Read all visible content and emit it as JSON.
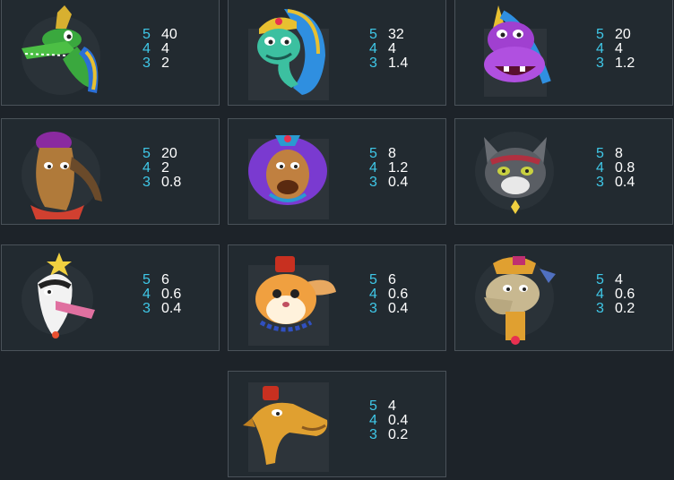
{
  "paytable": {
    "symbols": [
      {
        "icon": "crocodile-pharaoh-icon",
        "pays": [
          {
            "count": "5",
            "value": "40"
          },
          {
            "count": "4",
            "value": "4"
          },
          {
            "count": "3",
            "value": "2"
          }
        ]
      },
      {
        "icon": "cobra-icon",
        "pays": [
          {
            "count": "5",
            "value": "32"
          },
          {
            "count": "4",
            "value": "4"
          },
          {
            "count": "3",
            "value": "1.4"
          }
        ]
      },
      {
        "icon": "hippo-icon",
        "pays": [
          {
            "count": "5",
            "value": "20"
          },
          {
            "count": "4",
            "value": "4"
          },
          {
            "count": "3",
            "value": "1.2"
          }
        ]
      },
      {
        "icon": "goat-icon",
        "pays": [
          {
            "count": "5",
            "value": "20"
          },
          {
            "count": "4",
            "value": "2"
          },
          {
            "count": "3",
            "value": "0.8"
          }
        ]
      },
      {
        "icon": "lion-icon",
        "pays": [
          {
            "count": "5",
            "value": "8"
          },
          {
            "count": "4",
            "value": "1.2"
          },
          {
            "count": "3",
            "value": "0.4"
          }
        ]
      },
      {
        "icon": "cat-icon",
        "pays": [
          {
            "count": "5",
            "value": "8"
          },
          {
            "count": "4",
            "value": "0.8"
          },
          {
            "count": "3",
            "value": "0.4"
          }
        ]
      },
      {
        "icon": "ibis-bird-icon",
        "pays": [
          {
            "count": "5",
            "value": "6"
          },
          {
            "count": "4",
            "value": "0.6"
          },
          {
            "count": "3",
            "value": "0.4"
          }
        ]
      },
      {
        "icon": "hamster-icon",
        "pays": [
          {
            "count": "5",
            "value": "6"
          },
          {
            "count": "4",
            "value": "0.6"
          },
          {
            "count": "3",
            "value": "0.4"
          }
        ]
      },
      {
        "icon": "llama-icon",
        "pays": [
          {
            "count": "5",
            "value": "4"
          },
          {
            "count": "4",
            "value": "0.6"
          },
          {
            "count": "3",
            "value": "0.2"
          }
        ]
      },
      {
        "icon": "camel-icon",
        "pays": [
          {
            "count": "5",
            "value": "4"
          },
          {
            "count": "4",
            "value": "0.4"
          },
          {
            "count": "3",
            "value": "0.2"
          }
        ]
      }
    ]
  },
  "colors": {
    "background": "#1d2329",
    "card_border": "#4a5259",
    "count_text": "#3fc8e8",
    "value_text": "#ffffff"
  }
}
